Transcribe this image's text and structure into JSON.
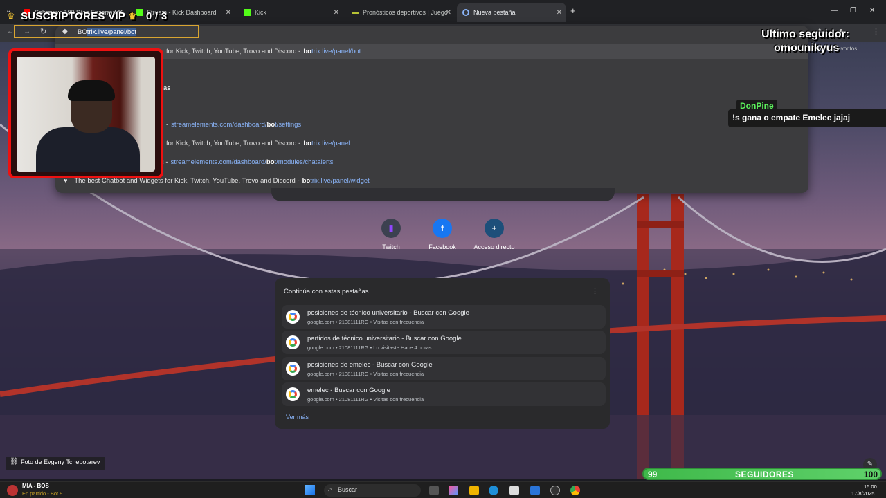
{
  "tabs": [
    {
      "title": "Sobrevivo 100 Días Encerrado",
      "icon": "youtube-icon",
      "color": "#ff0000"
    },
    {
      "title": "Stream - Kick Dashboard",
      "icon": "kick-icon",
      "color": "#53fc18"
    },
    {
      "title": "Kick",
      "icon": "kick-icon",
      "color": "#53fc18"
    },
    {
      "title": "Pronósticos deportivos | Juegos",
      "icon": "bet-icon",
      "color": "#b6c234"
    },
    {
      "title": "Nueva pestaña",
      "icon": "chrome-icon",
      "color": "#8ab4f8"
    }
  ],
  "address": {
    "typed": "BO",
    "autocomplete": "trix.live/panel/bot"
  },
  "bookmarks_label": "Todos los favoritos",
  "suggestions": [
    {
      "desc": "for Kick, Twitch, YouTube, Trovo and Discord",
      "sep": "-",
      "bold": "bo",
      "rest": "trix.live/panel/bot"
    },
    {
      "desc": "as",
      "sep": "",
      "bold": "",
      "rest": ""
    },
    {
      "desc": "-",
      "sep": "",
      "bold": "",
      "rest": "streamelements.com/dashboard/",
      "bold2": "bo",
      "rest2": "t/settings"
    },
    {
      "desc": "for Kick, Twitch, YouTube, Trovo and Discord",
      "sep": "-",
      "bold": "bo",
      "rest": "trix.live/panel"
    },
    {
      "desc": "s",
      "sep": "-",
      "bold": "",
      "rest": "streamelements.com/dashboard/",
      "bold2": "bo",
      "rest2": "t/modules/chatalerts"
    },
    {
      "desc": "The best Chatbot and Widgets for Kick, Twitch, YouTube, Trovo and Discord",
      "sep": "-",
      "bold": "bo",
      "rest": "trix.live/panel/widget"
    }
  ],
  "overlay": {
    "vip_title": "SUSCRIPTORES VIP",
    "vip_count": "0  / 3",
    "follower_label": "Ultimo seguidor:",
    "follower_name": "omounikyus",
    "chat_user": "DonPine",
    "chat_message": "!s gana o empate Emelec jajaj",
    "followers_current": "99",
    "followers_label": "SEGUIDORES",
    "followers_goal": "100",
    "followers_progress": 0.99
  },
  "shortcuts": [
    {
      "label": "Twitch",
      "glyph": "T",
      "color": "#9146ff"
    },
    {
      "label": "Facebook",
      "glyph": "f",
      "color": "#1877f2"
    },
    {
      "label": "Acceso directo",
      "glyph": "+",
      "color": "#ffffff"
    }
  ],
  "continue_card": {
    "title": "Continúa con estas pestañas",
    "items": [
      {
        "title": "posiciones de técnico universitario - Buscar con Google",
        "sub": "google.com • 21081111RG • Visitas con frecuencia"
      },
      {
        "title": "partidos de técnico universitario - Buscar con Google",
        "sub": "google.com • 21081111RG • Lo visitaste Hace 4 horas."
      },
      {
        "title": "posiciones de emelec - Buscar con Google",
        "sub": "google.com • 21081111RG • Visitas con frecuencia"
      },
      {
        "title": "emelec - Buscar con Google",
        "sub": "google.com • 21081111RG • Visitas con frecuencia"
      }
    ],
    "more": "Ver más"
  },
  "photo_credit": "Foto de Evgeny Tchebotarev",
  "taskbar": {
    "weather_title": "MIA - BOS",
    "weather_sub": "En partido - Bot 9",
    "search": "Buscar",
    "time": "15:00",
    "date": "17/8/2025"
  }
}
